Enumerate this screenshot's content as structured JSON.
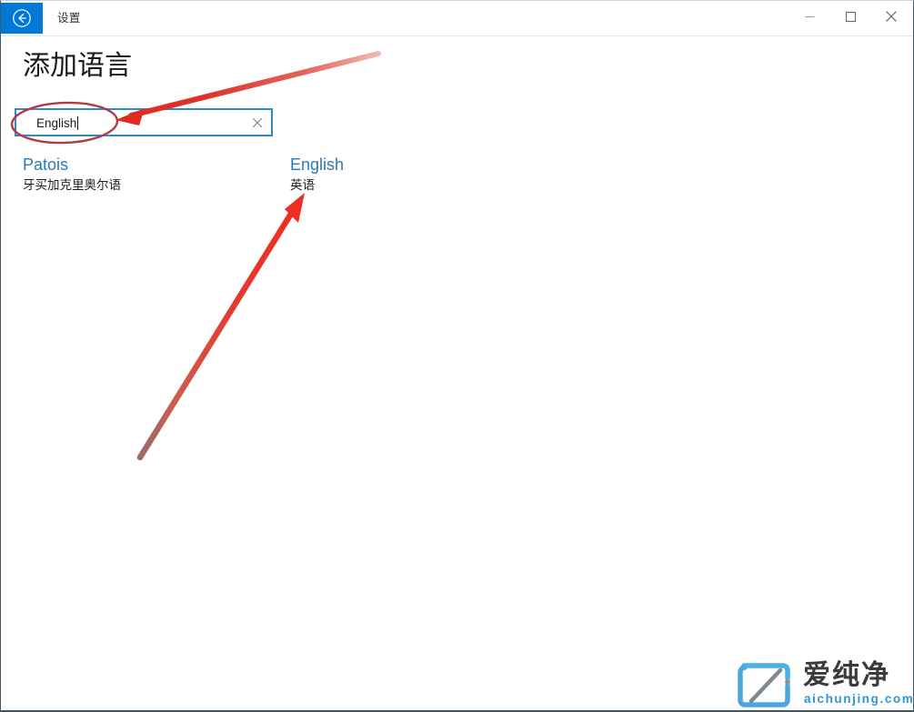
{
  "window": {
    "title": "设置",
    "back_icon": "back-arrow-icon",
    "controls": {
      "minimize_icon": "minimize-icon",
      "maximize_icon": "maximize-icon",
      "close_icon": "close-icon"
    },
    "accent_color": "#0078d7"
  },
  "page": {
    "heading": "添加语言"
  },
  "search": {
    "value": "English",
    "placeholder": "",
    "clear_icon": "close-icon",
    "border_color": "#2e8bc7"
  },
  "results": [
    {
      "name": "Patois",
      "native_name": "牙买加克里奥尔语"
    },
    {
      "name": "English",
      "native_name": "英语"
    }
  ],
  "annotations": {
    "ellipse": {
      "name": "red-ellipse-highlight",
      "color": "#b03a48"
    },
    "arrow_to_search": {
      "name": "red-arrow-to-search-box",
      "color": "#e03127"
    },
    "arrow_to_english": {
      "name": "red-arrow-to-english-result",
      "color": "#e03127"
    }
  },
  "watermark": {
    "brand": "爱纯净",
    "domain": "aichunjing.com",
    "logo_icon": "aichunjing-logo-icon",
    "accent_color": "#2e96d6"
  }
}
